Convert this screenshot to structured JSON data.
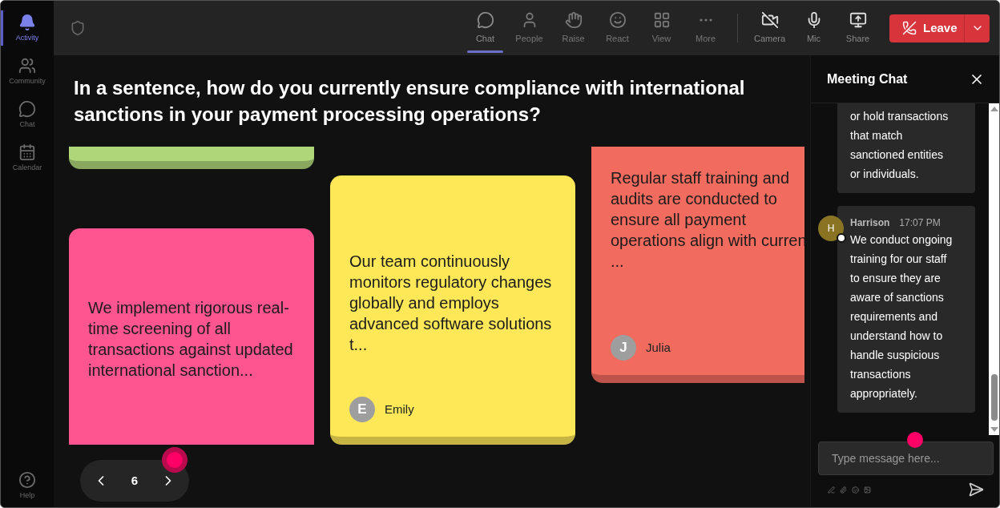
{
  "sidebar": {
    "items": [
      {
        "label": "Activity",
        "selected": true
      },
      {
        "label": "Community",
        "selected": false
      },
      {
        "label": "Chat",
        "selected": false
      },
      {
        "label": "Calendar",
        "selected": false
      }
    ],
    "help": {
      "label": "Help"
    }
  },
  "toolbar": {
    "items": [
      {
        "label": "Chat",
        "selected": true
      },
      {
        "label": "People",
        "selected": false
      },
      {
        "label": "Raise",
        "selected": false
      },
      {
        "label": "React",
        "selected": false
      },
      {
        "label": "View",
        "selected": false
      },
      {
        "label": "More",
        "selected": false
      }
    ],
    "devices": [
      {
        "label": "Camera"
      },
      {
        "label": "Mic"
      },
      {
        "label": "Share"
      }
    ],
    "leave_button": {
      "label": "Leave"
    }
  },
  "question": "In a sentence, how do you currently ensure compliance with international sanctions in your payment processing operations?",
  "board": {
    "columns": [
      {
        "cards": [
          {
            "color": "#b0d67a"
          },
          {
            "color": "#fe5590",
            "text": "We implement rigorous real-time screening of all transactions against updated international sanction..."
          }
        ]
      },
      {
        "cards": [
          {
            "color": "#fee857",
            "text": "Our team continuously monitors regulatory changes globally and employs advanced software solutions t...",
            "author": {
              "initial": "E",
              "name": "Emily"
            }
          }
        ]
      },
      {
        "cards": [
          {
            "color": "#f26b5f",
            "text": "Regular staff training and audits are conducted to ensure all payment operations align with curren\n...",
            "author": {
              "initial": "J",
              "name": "Julia"
            }
          }
        ]
      }
    ]
  },
  "pager": {
    "page": "6"
  },
  "chat": {
    "title": "Meeting Chat",
    "messages": [
      {
        "text": "or hold transactions that match sanctioned entities or individuals."
      },
      {
        "author": "Harrison",
        "initial": "H",
        "time": "17:07 PM",
        "text": "We conduct ongoing training for our staff to ensure they are aware of sanctions requirements and understand how to handle suspicious transactions appropriately."
      }
    ],
    "input": {
      "placeholder": "Type message here..."
    }
  }
}
